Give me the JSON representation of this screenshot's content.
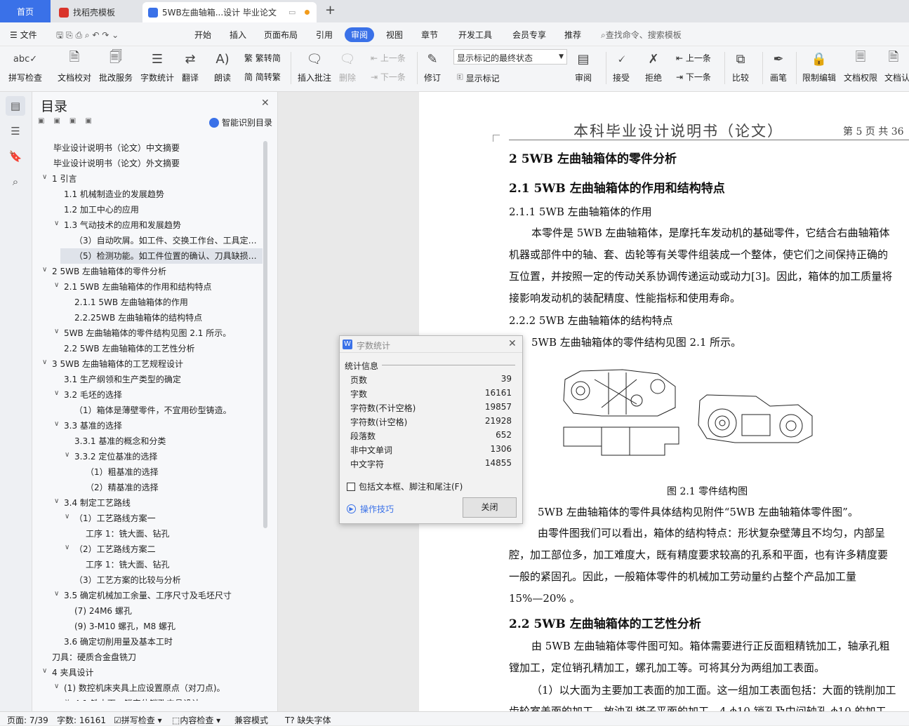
{
  "tabs": {
    "home": "首页",
    "template": "找稻壳模板",
    "doc": "5WB左曲轴箱...设计 毕业论文",
    "new_tab": "+"
  },
  "menu": {
    "file": "文件",
    "items": [
      "开始",
      "插入",
      "页面布局",
      "引用",
      "审阅",
      "视图",
      "章节",
      "开发工具",
      "会员专享",
      "推荐"
    ],
    "search": "查找命令、搜索模板"
  },
  "ribbon": {
    "spellcheck": "拼写检查",
    "doc_proof": "文档校对",
    "batch": "批改服务",
    "wordcount": "字数统计",
    "translate": "翻译",
    "read": "朗读",
    "to_trad": "繁转简",
    "to_simp": "简转繁",
    "insert_comment": "插入批注",
    "delete": "删除",
    "prev": "上一条",
    "next": "下一条",
    "revise": "修订",
    "markup_state": "显示标记的最终状态",
    "show_markup": "显示标记",
    "review": "审阅",
    "accept": "接受",
    "reject": "拒绝",
    "prev2": "上一条",
    "next2": "下一条",
    "compare": "比较",
    "pen": "画笔",
    "restrict": "限制编辑",
    "doc_rights": "文档权限",
    "doc_auth": "文档认"
  },
  "toc": {
    "title": "目录",
    "smart": "智能识别目录",
    "items": [
      {
        "text": "毕业设计说明书（论文）中文摘要",
        "level": 0,
        "arrow": false
      },
      {
        "text": "毕业设计说明书（论文）外文摘要",
        "level": 0,
        "arrow": false
      },
      {
        "text": "1   引言",
        "level": 0,
        "arrow": true
      },
      {
        "text": "1.1   机械制造业的发展趋势",
        "level": 1,
        "arrow": false
      },
      {
        "text": "1.2   加工中心的应用",
        "level": 1,
        "arrow": false
      },
      {
        "text": "1.3   气动技术的应用和发展趋势",
        "level": 1,
        "arrow": true
      },
      {
        "text": "（3）自动吹屑。如工件、交换工作台、工具定…",
        "level": 2,
        "arrow": false
      },
      {
        "text": "（5）检测功能。如工件位置的确认、刀具缺损…",
        "level": 2,
        "arrow": false,
        "selected": true
      },
      {
        "text": "2   5WB 左曲轴箱体的零件分析",
        "level": 0,
        "arrow": true
      },
      {
        "text": "2.1   5WB 左曲轴箱体的作用和结构特点",
        "level": 1,
        "arrow": true
      },
      {
        "text": "2.1.1   5WB 左曲轴箱体的作用",
        "level": 2,
        "arrow": false
      },
      {
        "text": "2.2.25WB 左曲轴箱体的结构特点",
        "level": 2,
        "arrow": false
      },
      {
        "text": "5WB 左曲轴箱体的零件结构见图 2.1 所示。",
        "level": 1,
        "arrow": true
      },
      {
        "text": "2.2   5WB 左曲轴箱体的工艺性分析",
        "level": 1,
        "arrow": false
      },
      {
        "text": "3   5WB 左曲轴箱体的工艺规程设计",
        "level": 0,
        "arrow": true
      },
      {
        "text": "3.1   生产纲领和生产类型的确定",
        "level": 1,
        "arrow": false
      },
      {
        "text": "3.2   毛坯的选择",
        "level": 1,
        "arrow": true
      },
      {
        "text": "（1）箱体是薄壁零件，不宜用砂型铸造。",
        "level": 2,
        "arrow": false
      },
      {
        "text": "3.3   基准的选择",
        "level": 1,
        "arrow": true
      },
      {
        "text": "3.3.1   基准的概念和分类",
        "level": 2,
        "arrow": false
      },
      {
        "text": "3.3.2   定位基准的选择",
        "level": 2,
        "arrow": true
      },
      {
        "text": "（1）粗基准的选择",
        "level": 3,
        "arrow": false
      },
      {
        "text": "（2）精基准的选择",
        "level": 3,
        "arrow": false
      },
      {
        "text": "3.4   制定工艺路线",
        "level": 1,
        "arrow": true
      },
      {
        "text": "（1）工艺路线方案一",
        "level": 2,
        "arrow": true
      },
      {
        "text": "工序 1：铣大面、钻孔",
        "level": 3,
        "arrow": false
      },
      {
        "text": "（2）工艺路线方案二",
        "level": 2,
        "arrow": true
      },
      {
        "text": "工序 1：铣大面、钻孔",
        "level": 3,
        "arrow": false
      },
      {
        "text": "（3）工艺方案的比较与分析",
        "level": 2,
        "arrow": false
      },
      {
        "text": "3.5   确定机械加工余量、工序尺寸及毛坯尺寸",
        "level": 1,
        "arrow": true
      },
      {
        "text": "(7) 24M6 螺孔",
        "level": 2,
        "arrow": false
      },
      {
        "text": "(9) 3-M10 螺孔，M8 螺孔",
        "level": 2,
        "arrow": false
      },
      {
        "text": "3.6   确定切削用量及基本工时",
        "level": 1,
        "arrow": false
      },
      {
        "text": "刀具：硬质合金盘铣刀",
        "level": 0,
        "arrow": false
      },
      {
        "text": "4   夹具设计",
        "level": 0,
        "arrow": true
      },
      {
        "text": "(1) 数控机床夹具上应设置原点（对刀点)。",
        "level": 1,
        "arrow": true
      },
      {
        "text": "4.1   铣大面、镗定位销孔夹具设计",
        "level": 2,
        "arrow": true
      }
    ]
  },
  "document": {
    "header_title": "本科毕业设计说明书（论文）",
    "header_page": "第 5 页  共 36",
    "h2": "2    5WB 左曲轴箱体的零件分析",
    "h21": "2.1    5WB 左曲轴箱体的作用和结构特点",
    "h211": "2.1.1    5WB 左曲轴箱体的作用",
    "p1_l1": "本零件是 5WB 左曲轴箱体，是摩托车发动机的基础零件，它结合右曲轴箱体",
    "p1_l2": "机器或部件中的轴、套、齿轮等有关零件组装成一个整体，使它们之间保持正确的",
    "p1_l3": "互位置，并按照一定的传动关系协调传递运动或动力[3]。因此，箱体的加工质量将",
    "p1_l4": "接影响发动机的装配精度、性能指标和使用寿命。",
    "h222": "2.2.2      5WB 左曲轴箱体的结构特点",
    "p2": "5WB 左曲轴箱体的零件结构见图 2.1 所示。",
    "fig_caption": "图 2.1    零件结构图",
    "p3": "5WB 左曲轴箱体的零件具体结构见附件“5WB 左曲轴箱体零件图”。",
    "p4_l1": "由零件图我们可以看出，箱体的结构特点：形状复杂壁薄且不均匀，内部呈",
    "p4_l2": "腔，加工部位多，加工难度大，既有精度要求较高的孔系和平面，也有许多精度要",
    "p4_l3": "一般的紧固孔。因此，一般箱体零件的机械加工劳动量约占整个产品加工量",
    "p4_l4": "15%—20%  。",
    "h22": "2.2    5WB 左曲轴箱体的工艺性分析",
    "p5_l1": "由 5WB 左曲轴箱体零件图可知。箱体需要进行正反面粗精铣加工，轴承孔粗",
    "p5_l2": "镗加工，定位销孔精加工，螺孔加工等。可将其分为两组加工表面。",
    "p6_l1": "（1）以大面为主要加工表面的加工面。这一组加工表面包括：大面的铣削加工",
    "p6_l2": "齿轮室盖面的加工，放油孔塔子平面的加工，4-ϕ10 销孔及中间轴孔 ϕ10 的加工"
  },
  "dialog": {
    "title": "字数统计",
    "section": "统计信息",
    "rows": [
      {
        "label": "页数",
        "value": "39"
      },
      {
        "label": "字数",
        "value": "16161"
      },
      {
        "label": "字符数(不计空格)",
        "value": "19857"
      },
      {
        "label": "字符数(计空格)",
        "value": "21928"
      },
      {
        "label": "段落数",
        "value": "652"
      },
      {
        "label": "非中文单词",
        "value": "1306"
      },
      {
        "label": "中文字符",
        "value": "14855"
      }
    ],
    "checkbox": "包括文本框、脚注和尾注(F)",
    "tips": "操作技巧",
    "close": "关闭"
  },
  "status": {
    "page": "页面: 7/39",
    "words": "字数: 16161",
    "spell": "拼写检查",
    "content": "内容检查",
    "compat": "兼容模式",
    "font": "缺失字体"
  },
  "colors": {
    "accent": "#3a71e8",
    "wps_red": "#d9342b"
  }
}
